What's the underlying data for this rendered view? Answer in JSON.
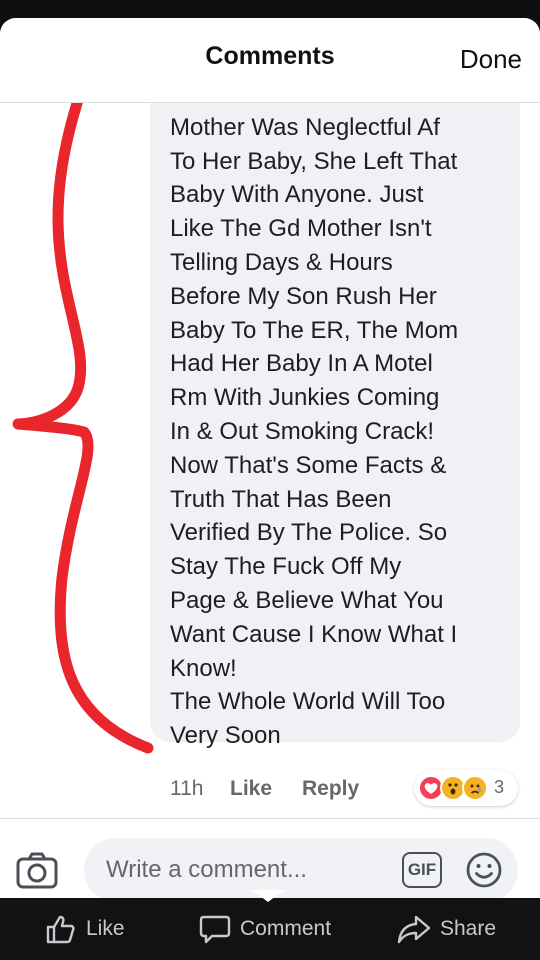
{
  "header": {
    "title": "Comments",
    "done_label": "Done"
  },
  "comment": {
    "text": "Read Isn't The Truth! The\nMother Was Neglectful Af\nTo Her Baby, She Left That\nBaby With Anyone. Just\nLike The Gd Mother Isn't\nTelling Days & Hours\nBefore My Son Rush Her\nBaby To The ER, The Mom\nHad Her Baby In A Motel\nRm With Junkies Coming\nIn & Out Smoking Crack!\nNow That's Some Facts &\nTruth That  Has Been\nVerified By The Police. So\nStay The Fuck Off My\nPage & Believe What You\nWant Cause I Know What I\nKnow!\nThe Whole World Will Too\nVery Soon",
    "time": "11h",
    "like_label": "Like",
    "reply_label": "Reply",
    "reactions": {
      "icons": [
        "love-icon",
        "wow-icon",
        "sad-icon"
      ],
      "count": "3"
    }
  },
  "composer": {
    "placeholder": "Write a comment...",
    "gif_label": "GIF"
  },
  "action_bar": {
    "like_label": "Like",
    "comment_label": "Comment",
    "share_label": "Share"
  },
  "colors": {
    "annotation": "#e8262c",
    "bubble": "#f0f1f4",
    "bar": "#111214"
  }
}
